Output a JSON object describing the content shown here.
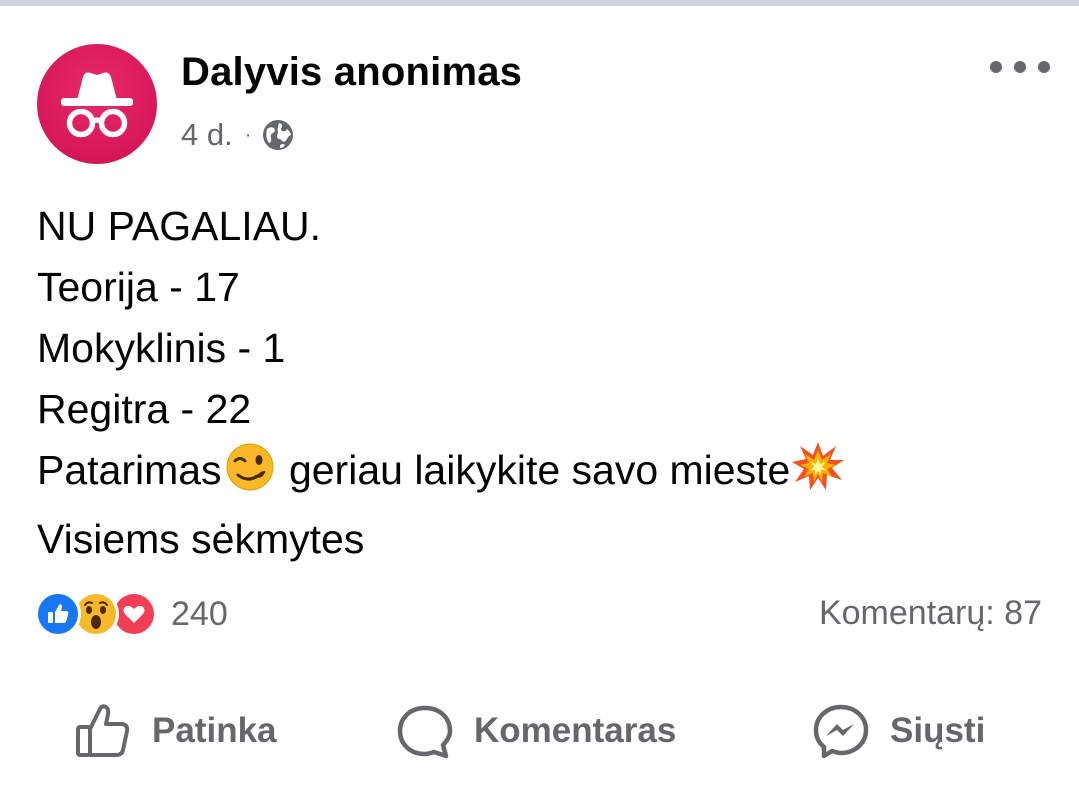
{
  "post": {
    "author": "Dalyvis anonimas",
    "time": "4 d.",
    "separator": "·",
    "privacy_icon": "globe-icon",
    "more_icon": "more-options-icon",
    "lines": [
      "NU PAGALIAU.",
      "Teorija - 17",
      "Mokyklinis - 1",
      "Regitra - 22",
      "Patarimas",
      " geriau laikykite savo mieste",
      "Visiems sėkmytes"
    ],
    "emojis": [
      "winking-face-emoji",
      "collision-emoji"
    ],
    "reactions": {
      "types": [
        "like",
        "wow",
        "love"
      ],
      "count": "240"
    },
    "comments_label": "Komentarų: 87"
  },
  "actions": {
    "like": "Patinka",
    "comment": "Komentaras",
    "share": "Siųsti"
  },
  "colors": {
    "avatar": "#d91a5a",
    "like": "#1877f2",
    "love": "#f33e58",
    "wow": "#f7b928",
    "secondary_text": "#65676b"
  }
}
